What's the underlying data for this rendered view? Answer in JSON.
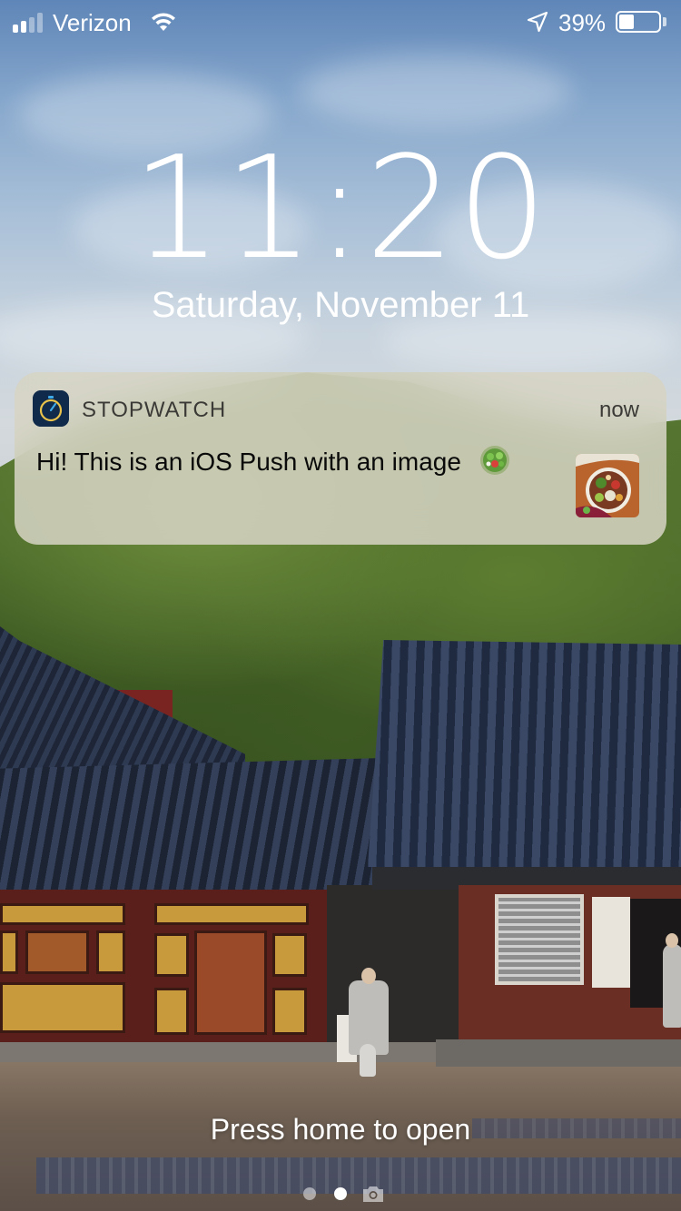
{
  "status_bar": {
    "carrier": "Verizon",
    "battery_percent": "39%",
    "battery_level": 0.39,
    "signal_bars_filled": 2,
    "signal_bars_total": 4,
    "icons": [
      "wifi-icon",
      "location-arrow-icon",
      "battery-icon"
    ]
  },
  "lock_screen": {
    "time": "11:20",
    "date": "Saturday, November 11"
  },
  "notification": {
    "app_name": "STOPWATCH",
    "timestamp": "now",
    "message": "Hi! This is an iOS Push with an image",
    "app_icon": "stopwatch-icon",
    "emoji": "salad-emoji",
    "attachment": "food-thumbnail"
  },
  "bottom": {
    "hint": "Press home to open",
    "page_count": 2,
    "active_page": 2
  },
  "colors": {
    "notification_bg": "#d6d4c4",
    "app_icon_bg": "#0f2a4a",
    "text_dark": "#0a0a0a",
    "text_secondary": "#3b3a36"
  }
}
